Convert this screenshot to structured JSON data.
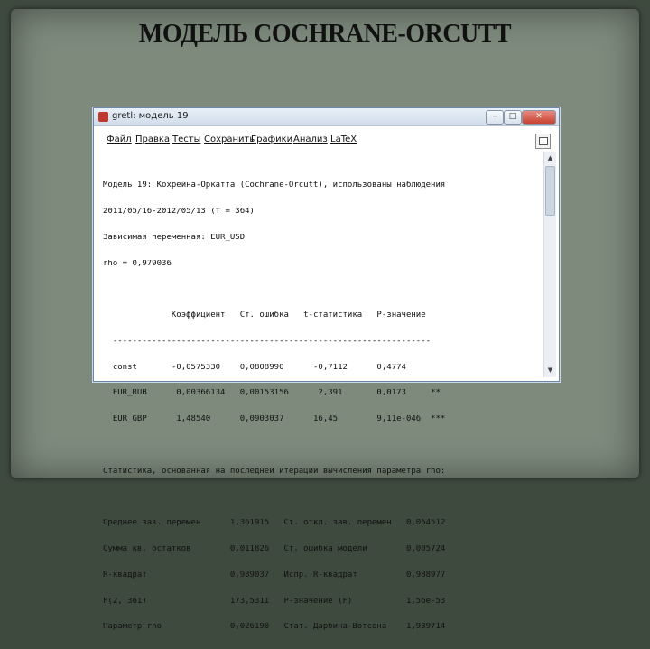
{
  "slide": {
    "title": "МОДЕЛЬ COCHRANE-ORCUTT"
  },
  "window": {
    "title": "gretl: модель 19",
    "controls": {
      "minimize": "–",
      "maximize": "□",
      "close": "✕"
    }
  },
  "menu": [
    {
      "label": "Файл"
    },
    {
      "label": "Правка"
    },
    {
      "label": "Тесты"
    },
    {
      "label": "Сохранить"
    },
    {
      "label": "Графики"
    },
    {
      "label": "Анализ"
    },
    {
      "label": "LaTeX"
    }
  ],
  "output": {
    "lines": [
      "Модель 19: Кохрейна-Оркатта (Cochrane-Orcutt), использованы наблюдения",
      "2011/05/16-2012/05/13 (T = 364)",
      "Зависимая переменная: EUR_USD",
      "rho = 0,979036",
      "",
      "              Коэффициент   Ст. ошибка   t-статистика   P-значение",
      "  -----------------------------------------------------------------",
      "  const       -0,0575330    0,0808990      -0,7112      0,4774",
      "  EUR_RUB      0,00366134   0,00153156      2,391       0,0173     **",
      "  EUR_GBP      1,48540      0,0903037      16,45        9,11e-046  ***",
      "",
      "Статистика, основанная на последней итерации вычисления параметра rho:",
      "",
      "Среднее зав. перемен      1,361915   Ст. откл. зав. перемен   0,054512",
      "Сумма кв. остатков        0,011826   Ст. ошибка модели        0,005724",
      "R-квадрат                 0,989037   Испр. R-квадрат          0,988977",
      "F(2, 361)                 173,5311   P-значение (F)           1,56e-53",
      "Параметр rho              0,026190   Стат. Дарбина-Вотсона    1,939714"
    ]
  },
  "scrollbar": {
    "up": "▲",
    "down": "▼"
  }
}
